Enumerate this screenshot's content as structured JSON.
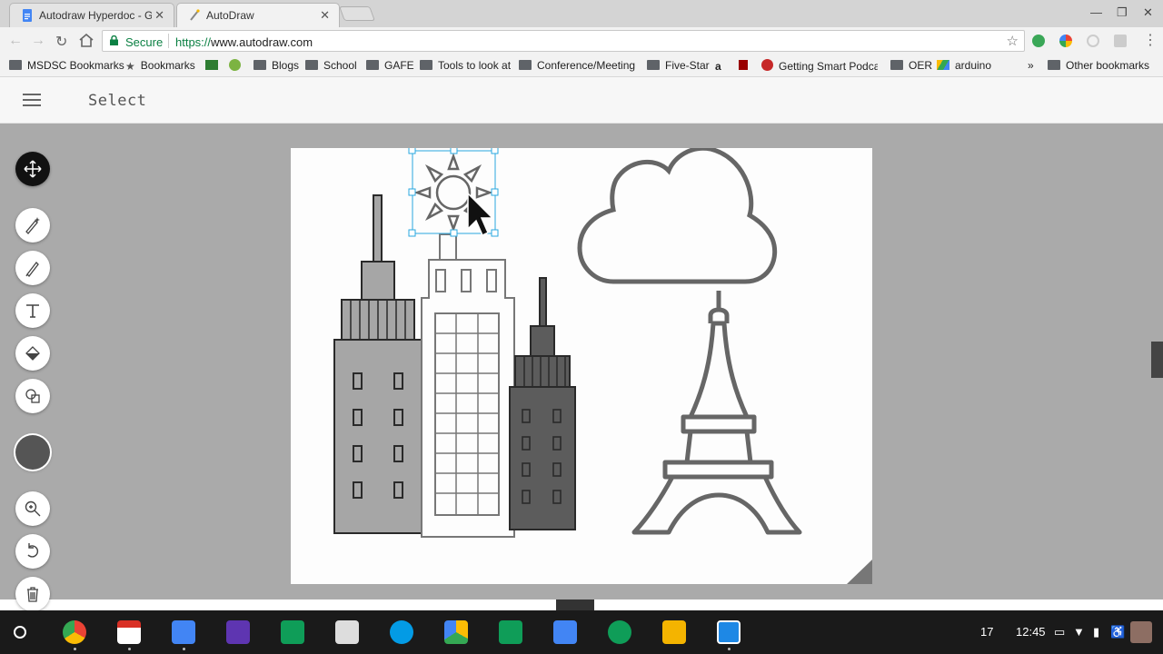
{
  "browser": {
    "tabs": [
      {
        "title": "Autodraw Hyperdoc - Go",
        "active": false,
        "favicon": "docs-icon"
      },
      {
        "title": "AutoDraw",
        "active": true,
        "favicon": "autodraw-icon"
      }
    ],
    "security_label": "Secure",
    "url_scheme": "https://",
    "url_host": "www.autodraw.com"
  },
  "bookmarks": [
    {
      "label": "MSDSC Bookmarks",
      "icon": "folder-icon"
    },
    {
      "label": "Bookmarks",
      "icon": "star-icon"
    },
    {
      "label": "",
      "icon": "np-icon"
    },
    {
      "label": "",
      "icon": "s-icon"
    },
    {
      "label": "Blogs",
      "icon": "folder-icon"
    },
    {
      "label": "School",
      "icon": "folder-icon"
    },
    {
      "label": "GAFE",
      "icon": "folder-icon"
    },
    {
      "label": "Tools to look at",
      "icon": "folder-icon"
    },
    {
      "label": "Conference/Meeting I",
      "icon": "folder-icon"
    },
    {
      "label": "Five-Star",
      "icon": "folder-icon"
    },
    {
      "label": "",
      "icon": "amazon-icon"
    },
    {
      "label": "",
      "icon": "iu-icon"
    },
    {
      "label": "Getting Smart Podca",
      "icon": "podcast-icon"
    },
    {
      "label": "OER",
      "icon": "folder-icon"
    },
    {
      "label": "arduino",
      "icon": "drive-icon"
    },
    {
      "label": "»",
      "icon": ""
    },
    {
      "label": "Other bookmarks",
      "icon": "folder-icon"
    }
  ],
  "app": {
    "mode_title": "Select",
    "tools": [
      "move-tool",
      "autodraw-tool",
      "draw-tool",
      "type-tool",
      "fill-tool",
      "shape-tool",
      "color-tool",
      "zoom-tool",
      "undo-tool",
      "delete-tool"
    ],
    "current_color": "#555555"
  },
  "tray": {
    "notification_count": "17",
    "time": "12:45"
  },
  "colors": {
    "workspace": "#aaaaaa",
    "selection": "#29a8e0",
    "building_light": "#a6a6a6",
    "building_dark": "#5c5c5c",
    "stroke": "#666666"
  }
}
